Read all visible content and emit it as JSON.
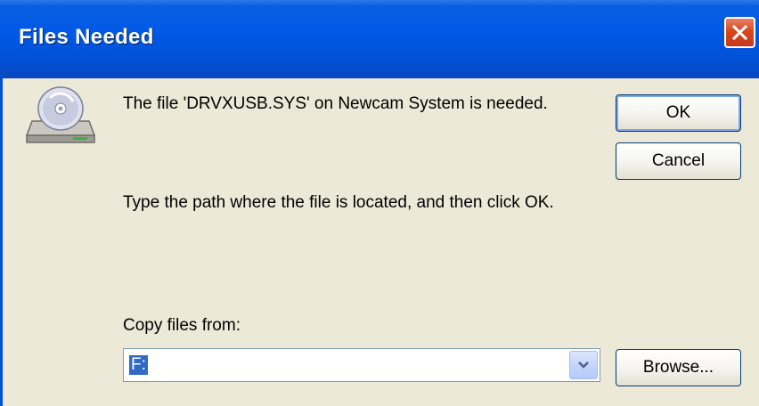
{
  "window": {
    "title": "Files Needed",
    "close_icon": "close-icon",
    "icon": "cd-drive-icon"
  },
  "message": {
    "line1": "The file 'DRVXUSB.SYS' on Newcam System is needed.",
    "line2": "Type the path where the file is located, and then click OK."
  },
  "copy_from": {
    "label": "Copy files from:",
    "value": "F:",
    "dropdown_icon": "chevron-down-icon"
  },
  "buttons": {
    "ok": "OK",
    "cancel": "Cancel",
    "browse": "Browse..."
  },
  "colors": {
    "titlebar": "#0052d6",
    "close": "#d9471f",
    "dialog_bg": "#ece9d8",
    "selection": "#316ac5"
  }
}
